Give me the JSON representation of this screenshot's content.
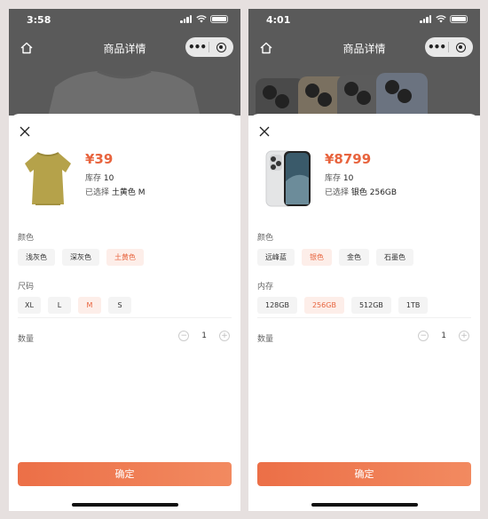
{
  "screens": [
    {
      "status_time": "3:58",
      "nav_title": "商品详情",
      "price": "¥39",
      "stock_label": "库存",
      "stock_value": "10",
      "chosen_label": "已选择",
      "chosen_value": "土黄色 M",
      "groups": [
        {
          "label": "颜色",
          "options": [
            "浅灰色",
            "深灰色",
            "土黄色"
          ],
          "active": "土黄色"
        },
        {
          "label": "尺码",
          "options": [
            "XL",
            "L",
            "M",
            "S"
          ],
          "active": "M"
        }
      ],
      "quantity_label": "数量",
      "quantity": "1",
      "confirm_label": "确定",
      "thumb_icon": "tshirt-icon"
    },
    {
      "status_time": "4:01",
      "nav_title": "商品详情",
      "price": "¥8799",
      "stock_label": "库存",
      "stock_value": "10",
      "chosen_label": "已选择",
      "chosen_value": "银色 256GB",
      "groups": [
        {
          "label": "颜色",
          "options": [
            "远峰蓝",
            "银色",
            "金色",
            "石墨色"
          ],
          "active": "银色"
        },
        {
          "label": "内存",
          "options": [
            "128GB",
            "256GB",
            "512GB",
            "1TB"
          ],
          "active": "256GB"
        }
      ],
      "quantity_label": "数量",
      "quantity": "1",
      "confirm_label": "确定",
      "thumb_icon": "phone-icon"
    }
  ],
  "colors": {
    "accent": "#e8643e",
    "chip_active_bg": "#fdeee9",
    "overlay": "#5a5a5a"
  }
}
